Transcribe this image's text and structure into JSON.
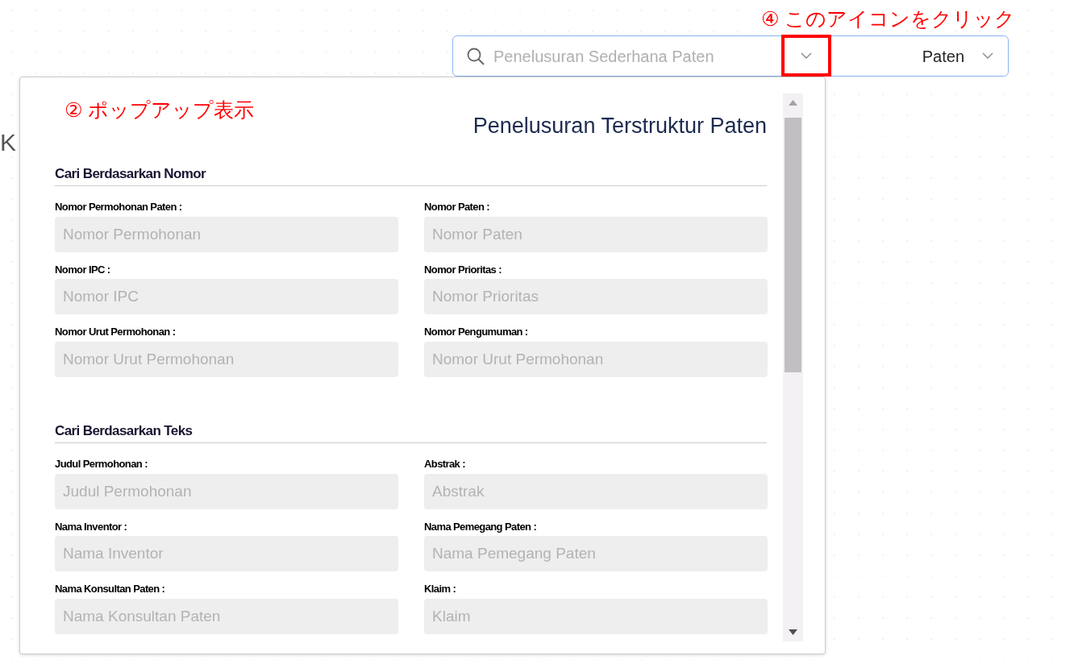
{
  "page": {
    "subtitle_fragment": "K"
  },
  "search_bar": {
    "placeholder": "Penelusuran Sederhana Paten",
    "category": "Paten"
  },
  "popup": {
    "title": "Penelusuran Terstruktur Paten",
    "sections": [
      {
        "heading": "Cari Berdasarkan Nomor",
        "fields": [
          {
            "label": "Nomor Permohonan Paten :",
            "placeholder": "Nomor Permohonan"
          },
          {
            "label": "Nomor Paten :",
            "placeholder": "Nomor Paten"
          },
          {
            "label": "Nomor IPC :",
            "placeholder": "Nomor IPC"
          },
          {
            "label": "Nomor Prioritas :",
            "placeholder": "Nomor Prioritas"
          },
          {
            "label": "Nomor Urut Permohonan :",
            "placeholder": "Nomor Urut Permohonan"
          },
          {
            "label": "Nomor Pengumuman :",
            "placeholder": "Nomor Urut Permohonan"
          }
        ]
      },
      {
        "heading": "Cari Berdasarkan Teks",
        "fields": [
          {
            "label": "Judul Permohonan :",
            "placeholder": "Judul Permohonan"
          },
          {
            "label": "Abstrak :",
            "placeholder": "Abstrak"
          },
          {
            "label": "Nama Inventor :",
            "placeholder": "Nama Inventor"
          },
          {
            "label": "Nama Pemegang Paten :",
            "placeholder": "Nama Pemegang Paten"
          },
          {
            "label": "Nama Konsultan Paten :",
            "placeholder": "Nama Konsultan Paten"
          },
          {
            "label": "Klaim :",
            "placeholder": "Klaim"
          }
        ]
      }
    ]
  },
  "annotations": [
    {
      "text": "② ポップアップ表示"
    },
    {
      "text": "④ このアイコンをクリック"
    }
  ]
}
